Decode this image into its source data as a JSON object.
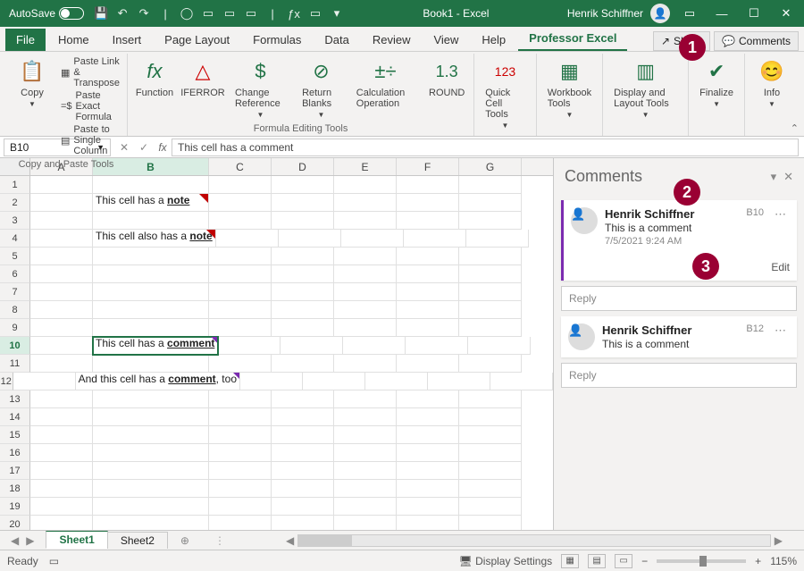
{
  "titlebar": {
    "autosave_label": "AutoSave",
    "book_title": "Book1 - Excel",
    "user_name": "Henrik Schiffner"
  },
  "tabs": {
    "file": "File",
    "items": [
      "Home",
      "Insert",
      "Page Layout",
      "Formulas",
      "Data",
      "Review",
      "View",
      "Help",
      "Professor Excel"
    ],
    "active_index": 8,
    "share_btn": "Share",
    "comments_btn": "Comments"
  },
  "ribbon": {
    "copy_big": "Copy",
    "paste_link": "Paste Link & Transpose",
    "paste_exact": "Paste Exact Formula",
    "paste_single": "Paste to Single Column",
    "group1_label": "Copy and Paste Tools",
    "function": "Function",
    "iferror": "IFERROR",
    "change_ref": "Change Reference",
    "return_blanks": "Return Blanks",
    "calc_op": "Calculation Operation",
    "round": "ROUND",
    "group2_label": "Formula Editing Tools",
    "quickcell": "Quick Cell Tools",
    "workbook": "Workbook Tools",
    "display": "Display and Layout Tools",
    "finalize": "Finalize",
    "info": "Info"
  },
  "formula_bar": {
    "name_box": "B10",
    "formula": "This cell has a comment"
  },
  "grid": {
    "columns": [
      "A",
      "B",
      "C",
      "D",
      "E",
      "F",
      "G"
    ],
    "rows": 20,
    "active_row": 10,
    "active_col": "B",
    "cells": {
      "B2": {
        "text_pre": "This cell has a ",
        "text_u": "note",
        "text_post": "",
        "note": true
      },
      "B4": {
        "text_pre": "This cell also has a ",
        "text_u": "note",
        "text_post": "",
        "note": true
      },
      "B10": {
        "text_pre": "This cell has a ",
        "text_u": "comment",
        "text_post": "",
        "comment": true,
        "selected": true
      },
      "B12": {
        "text_pre": "And this cell has a ",
        "text_u": "comment",
        "text_post": ", too",
        "comment": true
      }
    }
  },
  "comments_pane": {
    "title": "Comments",
    "threads": [
      {
        "author": "Henrik Schiffner",
        "text": "This is a comment",
        "date": "7/5/2021 9:24 AM",
        "ref": "B10",
        "active": true,
        "show_edit": true,
        "show_date": true
      },
      {
        "author": "Henrik Schiffner",
        "text": "This is a comment",
        "date": "",
        "ref": "B12",
        "active": false,
        "show_edit": false,
        "show_date": false
      }
    ],
    "edit_label": "Edit",
    "reply_placeholder": "Reply"
  },
  "sheetbar": {
    "tabs": [
      "Sheet1",
      "Sheet2"
    ],
    "active": 0
  },
  "statusbar": {
    "ready": "Ready",
    "display_settings": "Display Settings",
    "zoom": "115%"
  },
  "callouts": {
    "c1": "1",
    "c2": "2",
    "c3": "3"
  }
}
